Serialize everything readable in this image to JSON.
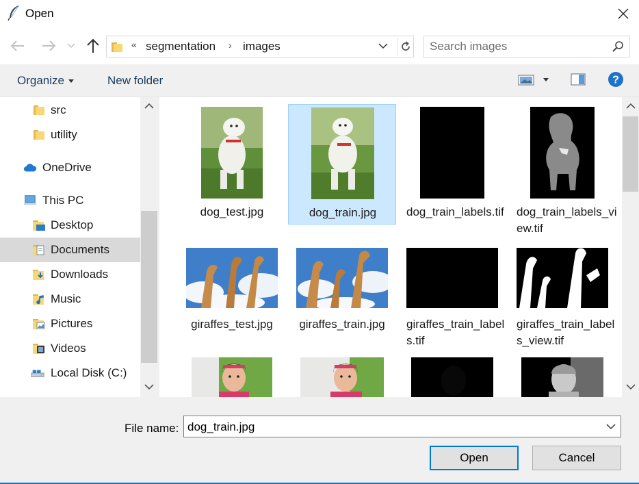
{
  "window": {
    "title": "Open"
  },
  "nav": {
    "breadcrumb_chevron": "«",
    "path": [
      "segmentation",
      "images"
    ],
    "path_separator": "›"
  },
  "search": {
    "placeholder": "Search images"
  },
  "toolbar": {
    "organize_label": "Organize",
    "new_folder_label": "New folder",
    "help_label": "?"
  },
  "sidebar": {
    "items": [
      {
        "label": "src",
        "icon": "folder-icon",
        "selected": false
      },
      {
        "label": "utility",
        "icon": "folder-icon",
        "selected": false
      },
      {
        "label": "OneDrive",
        "icon": "cloud-icon",
        "selected": false
      },
      {
        "label": "This PC",
        "icon": "computer-icon",
        "selected": false
      },
      {
        "label": "Desktop",
        "icon": "desktop-folder-icon",
        "selected": false
      },
      {
        "label": "Documents",
        "icon": "documents-folder-icon",
        "selected": true
      },
      {
        "label": "Downloads",
        "icon": "downloads-folder-icon",
        "selected": false
      },
      {
        "label": "Music",
        "icon": "music-folder-icon",
        "selected": false
      },
      {
        "label": "Pictures",
        "icon": "pictures-folder-icon",
        "selected": false
      },
      {
        "label": "Videos",
        "icon": "videos-folder-icon",
        "selected": false
      },
      {
        "label": "Local Disk (C:)",
        "icon": "drive-icon",
        "selected": false
      }
    ]
  },
  "files": [
    {
      "name": "dog_test.jpg",
      "thumb": "dog-photo",
      "selected": false
    },
    {
      "name": "dog_train.jpg",
      "thumb": "dog-photo",
      "selected": true
    },
    {
      "name": "dog_train_labels.tif",
      "thumb": "black",
      "selected": false
    },
    {
      "name": "dog_train_labels_view.tif",
      "thumb": "dog-mask",
      "selected": false
    },
    {
      "name": "giraffes_test.jpg",
      "thumb": "giraffe-photo",
      "selected": false
    },
    {
      "name": "giraffes_train.jpg",
      "thumb": "giraffe-photo",
      "selected": false
    },
    {
      "name": "giraffes_train_labels.tif",
      "thumb": "black",
      "selected": false
    },
    {
      "name": "giraffes_train_labels_view.tif",
      "thumb": "giraffe-mask",
      "selected": false
    },
    {
      "name": "",
      "thumb": "girl-photo",
      "selected": false
    },
    {
      "name": "",
      "thumb": "girl-photo",
      "selected": false
    },
    {
      "name": "",
      "thumb": "black",
      "selected": false
    },
    {
      "name": "",
      "thumb": "girl-mask",
      "selected": false
    }
  ],
  "footer": {
    "file_name_label": "File name:",
    "file_name_value": "dog_train.jpg",
    "open_label": "Open",
    "cancel_label": "Cancel"
  },
  "colors": {
    "accent": "#0078d7",
    "selection": "#cce8ff",
    "toolbar_bg": "#f0f0f0",
    "link_text": "#1a3a5f"
  }
}
